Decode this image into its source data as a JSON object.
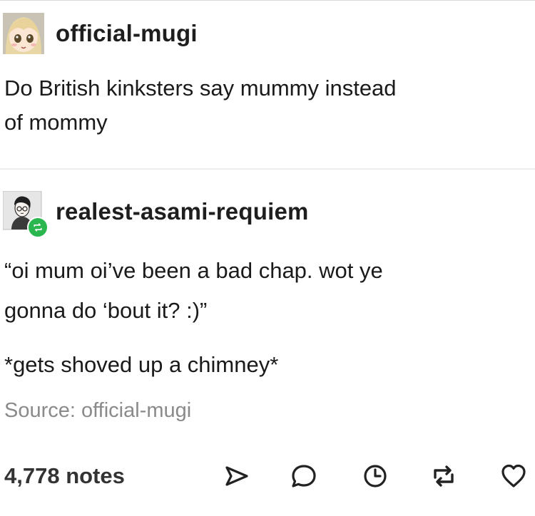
{
  "post": {
    "username": "official-mugi",
    "text_line1": "Do British kinksters say mummy instead",
    "text_line2": "of mommy"
  },
  "reblog": {
    "username": "realest-asami-requiem",
    "quote_line1": "“oi mum oi’ve been a bad chap. wot ye",
    "quote_line2": "gonna do ‘bout it? :)”",
    "action_line": "*gets shoved up a chimney*"
  },
  "source": "Source: official-mugi",
  "footer": {
    "notes": "4,778 notes",
    "actions": [
      "send-icon",
      "reply-icon",
      "history-icon",
      "reblog-icon",
      "like-icon"
    ]
  },
  "colors": {
    "reblog_badge": "#2bb74f",
    "source_text": "#8a8a8a"
  }
}
